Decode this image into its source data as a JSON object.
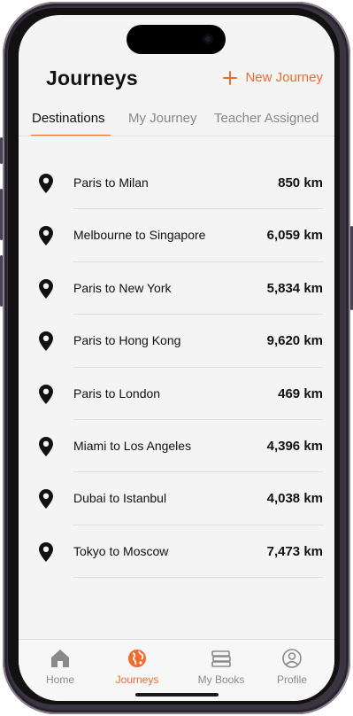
{
  "header": {
    "title": "Journeys",
    "new_journey_label": "New Journey"
  },
  "tabs": [
    {
      "label": "Destinations",
      "active": true
    },
    {
      "label": "My Journey",
      "active": false
    },
    {
      "label": "Teacher Assigned",
      "active": false
    }
  ],
  "journeys": [
    {
      "name": "Paris to Milan",
      "distance": "850 km"
    },
    {
      "name": "Melbourne to Singapore",
      "distance": "6,059 km"
    },
    {
      "name": "Paris to New York",
      "distance": "5,834 km"
    },
    {
      "name": "Paris to Hong Kong",
      "distance": "9,620 km"
    },
    {
      "name": "Paris to London",
      "distance": "469 km"
    },
    {
      "name": "Miami to Los Angeles",
      "distance": "4,396 km"
    },
    {
      "name": "Dubai to Istanbul",
      "distance": "4,038 km"
    },
    {
      "name": "Tokyo to Moscow",
      "distance": "7,473 km"
    }
  ],
  "tabbar": {
    "items": [
      {
        "label": "Home",
        "icon": "home-icon",
        "active": false
      },
      {
        "label": "Journeys",
        "icon": "globe-icon",
        "active": true
      },
      {
        "label": "My Books",
        "icon": "books-icon",
        "active": false
      },
      {
        "label": "Profile",
        "icon": "profile-icon",
        "active": false
      }
    ]
  },
  "colors": {
    "accent": "#f26a2e",
    "text": "#111111",
    "muted": "#888888",
    "background": "#f4f4f4"
  }
}
